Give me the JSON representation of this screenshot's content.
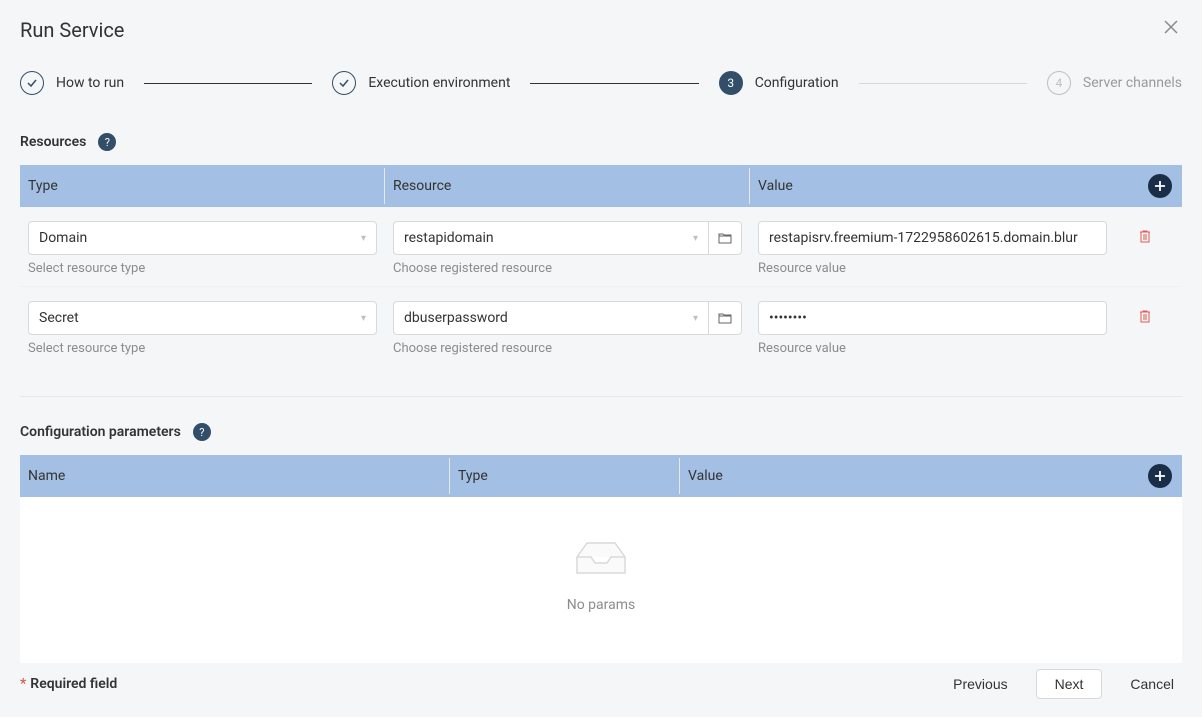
{
  "modal": {
    "title": "Run Service"
  },
  "steps": [
    {
      "label": "How to run",
      "state": "done"
    },
    {
      "label": "Execution environment",
      "state": "done"
    },
    {
      "label": "Configuration",
      "state": "current",
      "number": "3"
    },
    {
      "label": "Server channels",
      "state": "upcoming",
      "number": "4"
    }
  ],
  "resources": {
    "title": "Resources",
    "columns": {
      "type": "Type",
      "resource": "Resource",
      "value": "Value"
    },
    "hints": {
      "type": "Select resource type",
      "resource": "Choose registered resource",
      "value": "Resource value"
    },
    "rows": [
      {
        "type": "Domain",
        "resource": "restapidomain",
        "value": "restapisrv.freemium-1722958602615.domain.blur"
      },
      {
        "type": "Secret",
        "resource": "dbuserpassword",
        "value": "••••••••"
      }
    ]
  },
  "params": {
    "title": "Configuration parameters",
    "columns": {
      "name": "Name",
      "type": "Type",
      "value": "Value"
    },
    "empty_text": "No params"
  },
  "footer": {
    "required": "Required field",
    "previous": "Previous",
    "next": "Next",
    "cancel": "Cancel"
  }
}
